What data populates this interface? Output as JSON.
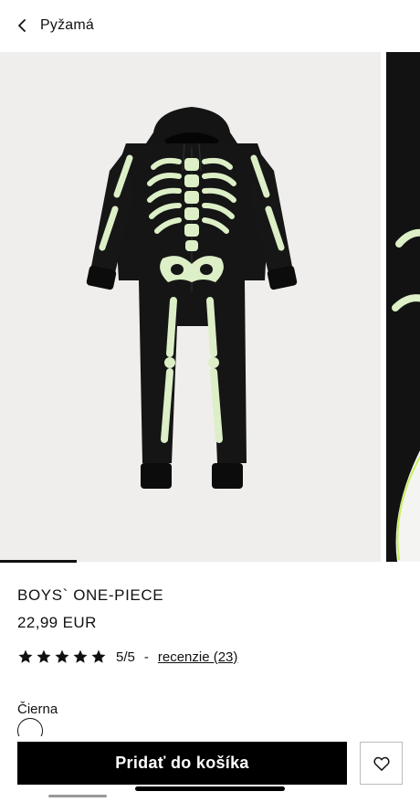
{
  "header": {
    "back_label": "Pyžamá",
    "back_icon": "chevron-left-icon"
  },
  "gallery": {
    "image_count_visible": 2,
    "progress": 0.18
  },
  "product": {
    "title": "BOYS` ONE-PIECE",
    "price": "22,99 EUR",
    "rating": {
      "stars": 5,
      "score": "5/5",
      "separator": "-",
      "reviews_label": "recenzie (23)"
    },
    "color_label": "Čierna"
  },
  "actions": {
    "add_to_cart_label": "Pridať do košíka",
    "favorite_icon": "heart-icon"
  },
  "colors": {
    "accent": "#000000",
    "background": "#ffffff",
    "image_bg": "#efeeec",
    "glow": "#dcefc7"
  }
}
